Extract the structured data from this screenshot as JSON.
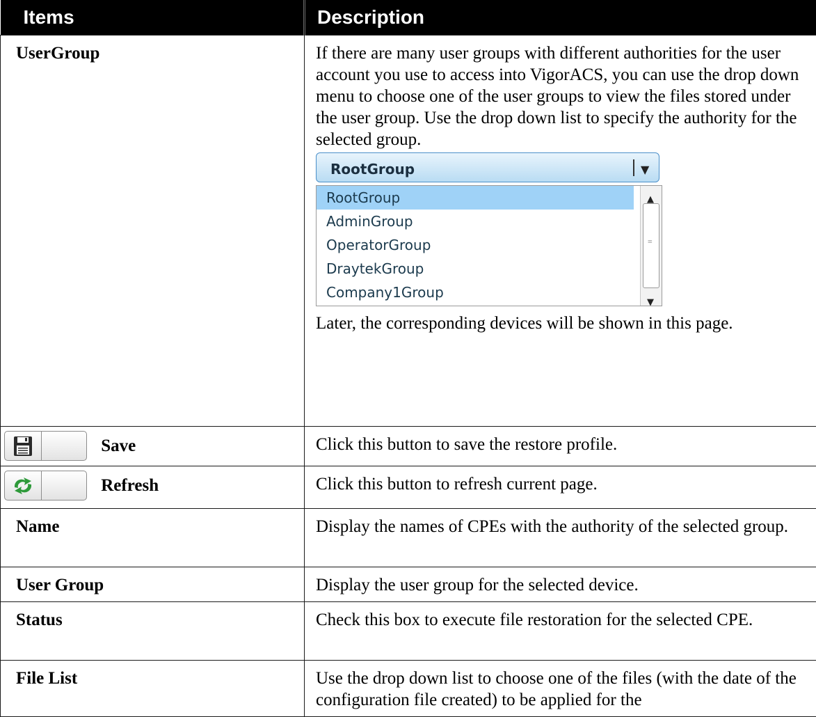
{
  "header": {
    "col1": "Items",
    "col2": "Description"
  },
  "rows": {
    "usergroup": {
      "item": "UserGroup",
      "desc": "If there are many user groups with different authorities for the user account you use to access into VigorACS, you can use the drop down menu to choose one of the user groups to view the files stored under the user group. Use the drop down list to specify the authority for the selected group.",
      "desc_after": "Later, the corresponding devices will be shown in this page.",
      "dropdown": {
        "selected": "RootGroup",
        "options": [
          "RootGroup",
          "AdminGroup",
          "OperatorGroup",
          "DraytekGroup",
          "Company1Group"
        ]
      }
    },
    "save": {
      "item": "Save",
      "desc": "Click this button to save the restore profile.",
      "icon": "floppy-disk-icon"
    },
    "refresh": {
      "item": "Refresh",
      "desc": "Click this button to refresh current page.",
      "icon": "refresh-arrows-icon",
      "icon_color": "#2e9a3a"
    },
    "name": {
      "item": "Name",
      "desc": "Display the names of CPEs with the authority of the selected group."
    },
    "user_group": {
      "item": "User Group",
      "desc": "Display the user group for the selected device."
    },
    "status": {
      "item": "Status",
      "desc": "Check this box to execute file restoration for the selected CPE."
    },
    "file_list": {
      "item": "File List",
      "desc": "Use the drop down list to choose one of the files (with the date of the configuration file created) to be applied for the"
    }
  }
}
